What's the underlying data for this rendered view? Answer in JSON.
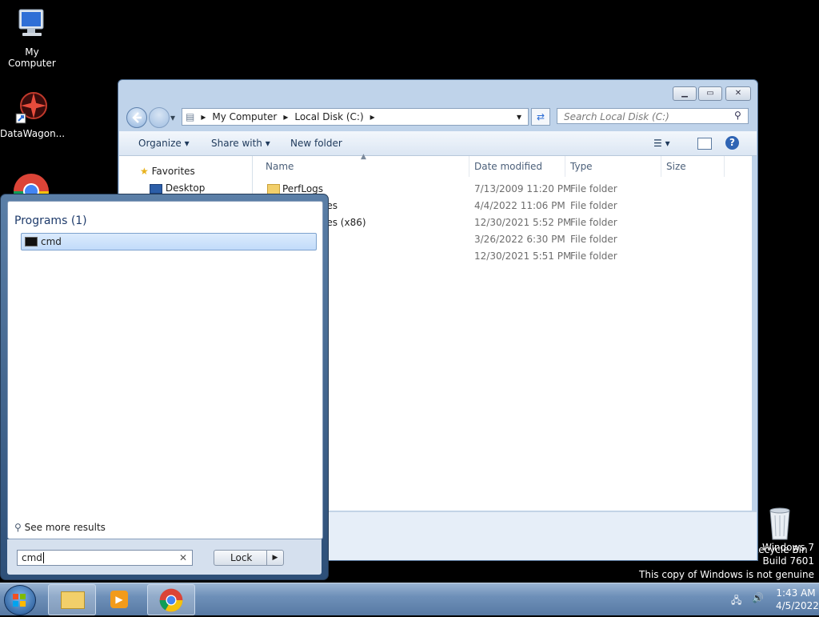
{
  "desktop": {
    "icons": [
      {
        "label": "My Computer",
        "icon": "computer-icon"
      },
      {
        "label": "DataWagon...",
        "icon": "datawagon-icon"
      },
      {
        "label": "Recycle Bin",
        "icon": "recycle-bin-icon"
      }
    ],
    "watermark": {
      "line1": "Windows 7",
      "line2": "Build 7601",
      "line3": "This copy of Windows is not genuine"
    }
  },
  "explorer": {
    "address": {
      "root": "My Computer",
      "drive": "Local Disk (C:)"
    },
    "search_placeholder": "Search Local Disk (C:)",
    "toolbar": {
      "organize": "Organize",
      "share": "Share with",
      "new_folder": "New folder"
    },
    "nav": {
      "favorites": "Favorites",
      "desktop": "Desktop"
    },
    "columns": {
      "name": "Name",
      "date": "Date modified",
      "type": "Type",
      "size": "Size"
    },
    "rows": [
      {
        "name": "PerfLogs",
        "date": "7/13/2009 11:20 PM",
        "type": "File folder"
      },
      {
        "name": "les",
        "date": "4/4/2022 11:06 PM",
        "type": "File folder"
      },
      {
        "name": "les (x86)",
        "date": "12/30/2021 5:52 PM",
        "type": "File folder"
      },
      {
        "name": "",
        "date": "3/26/2022 6:30 PM",
        "type": "File folder"
      },
      {
        "name": "",
        "date": "12/30/2021 5:51 PM",
        "type": "File folder"
      }
    ]
  },
  "startmenu": {
    "group_label": "Programs (1)",
    "result": "cmd",
    "see_more": "See more results",
    "search_value": "cmd",
    "lock_label": "Lock"
  },
  "taskbar": {
    "time": "1:43 AM",
    "date": "4/5/2022"
  }
}
